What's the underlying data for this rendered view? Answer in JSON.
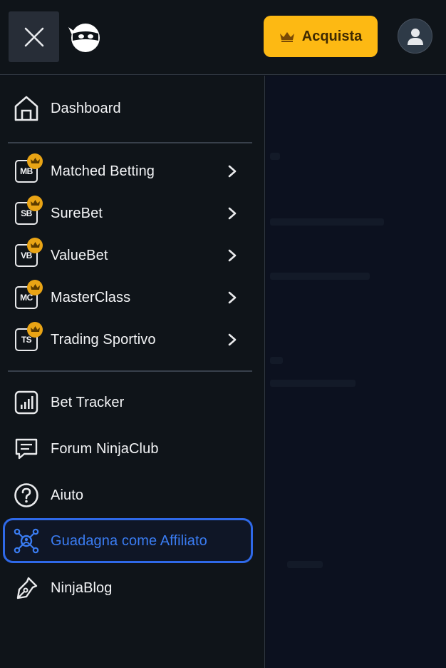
{
  "header": {
    "buy_label": "Acquista",
    "brand_color": "#fdb913",
    "close_icon": "close-icon",
    "logo_icon": "ninja-logo-icon",
    "avatar_icon": "user-icon"
  },
  "nav": {
    "dashboard": {
      "label": "Dashboard",
      "icon": "home-icon"
    },
    "premium": [
      {
        "label": "Matched Betting",
        "abbr": "MB"
      },
      {
        "label": "SureBet",
        "abbr": "SB"
      },
      {
        "label": "ValueBet",
        "abbr": "VB"
      },
      {
        "label": "MasterClass",
        "abbr": "MC"
      },
      {
        "label": "Trading Sportivo",
        "abbr": "TS"
      }
    ],
    "tools": [
      {
        "label": "Bet Tracker",
        "icon": "chart-icon"
      },
      {
        "label": "Forum NinjaClub",
        "icon": "chat-icon"
      },
      {
        "label": "Aiuto",
        "icon": "help-icon"
      },
      {
        "label": "Guadagna come Affiliato",
        "icon": "affiliate-icon",
        "active": true
      },
      {
        "label": "NinjaBlog",
        "icon": "pen-icon"
      }
    ]
  },
  "colors": {
    "active": "#2f69e8",
    "crown": "#e9a415"
  }
}
